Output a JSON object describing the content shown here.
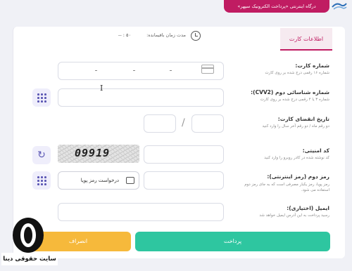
{
  "header": {
    "gateway_title": "درگاه اینترنتی «پرداخت الکترونیک سپهر»",
    "logo_icon": "sepehr-logo-icon"
  },
  "tabs": [
    {
      "label": "اطلاعات کارت",
      "active": true
    }
  ],
  "timer": {
    "label": "مدت زمان باقیمانده:",
    "value": "-- : ٥٠"
  },
  "form": {
    "card_number": {
      "label": "شماره کارت:",
      "hint": "شماره ۱۶ رقمی درج شده بر روی کارت",
      "value": ""
    },
    "cvv2": {
      "label": "شماره شناسائی دوم (CVV2):",
      "hint": "شماره ۳ یا ۴ رقمی درج شده بر روی کارت",
      "value": ""
    },
    "expiry": {
      "label": "تاریخ انقضای کارت:",
      "hint": "دو رقم ماه / دو رقم آخر سال را وارد کنید",
      "separator": "/",
      "month": "",
      "year": ""
    },
    "captcha": {
      "label": "کد امنیتی:",
      "hint": "کد نوشته شده در کادر روبرو را وارد کنید",
      "image_text": "09919",
      "value": ""
    },
    "otp": {
      "label": "رمز دوم (رمز اینترنتی):",
      "hint": "رمز پویا، رمز یکبار مصرفی است که به جای رمز دوم استفاده می شود.",
      "request_button": "درخواست رمز پویا",
      "value": ""
    },
    "email": {
      "label": "ایمیل (اختیاری):",
      "hint": "رسید پرداخت به این آدرس ایمیل خواهد شد",
      "value": ""
    }
  },
  "buttons": {
    "pay": "پرداخت",
    "cancel": "انصراف"
  },
  "watermark": {
    "text": "سایت حقوقی دینا"
  },
  "colors": {
    "brand": "#c01c62",
    "pay": "#2ec6a0",
    "cancel": "#f6b93b",
    "keypad": "#5b57b4"
  }
}
